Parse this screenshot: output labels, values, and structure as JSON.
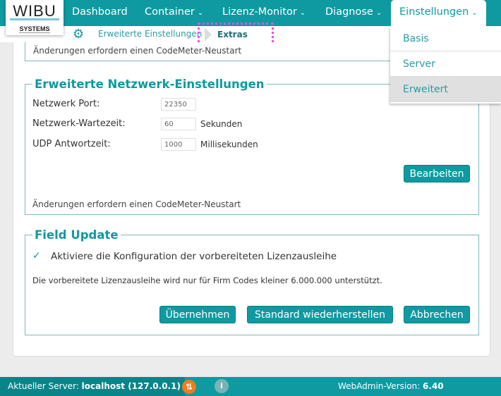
{
  "nav": {
    "logo_top": "WIBU",
    "logo_bottom": "SYSTEMS",
    "items": [
      "Dashboard",
      "Container",
      "Lizenz-Monitor",
      "Diagnose",
      "Einstellungen"
    ]
  },
  "breadcrumb": {
    "parent": "Erweiterte Einstellungen",
    "current": "Extras"
  },
  "dropdown": [
    "Basis",
    "Server",
    "Erweitert"
  ],
  "top_note": "Änderungen erfordern einen CodeMeter-Neustart",
  "network": {
    "title": "Erweiterte Netzwerk-Einstellungen",
    "port_label": "Netzwerk Port:",
    "port": "22350",
    "wait_label": "Netzwerk-Wartezeit:",
    "wait": "60",
    "wait_unit": "Sekunden",
    "udp_label": "UDP Antwortzeit:",
    "udp": "1000",
    "udp_unit": "Millisekunden",
    "edit": "Bearbeiten",
    "note": "Änderungen erfordern einen CodeMeter-Neustart"
  },
  "field_update": {
    "title": "Field Update",
    "checkbox": "Aktiviere die Konfiguration der vorbereiteten Lizenzausleihe",
    "checked": true,
    "info": "Die vorbereitete Lizenzausleihe wird nur für Firm Codes kleiner 6.000.000 unterstützt.",
    "apply": "Übernehmen",
    "reset": "Standard wiederherstellen",
    "cancel": "Abbrechen"
  },
  "footer": {
    "server_label": "Aktueller Server:",
    "server": "localhost (127.0.0.1)",
    "version_label": "WebAdmin-Version:",
    "version": "6.40"
  }
}
